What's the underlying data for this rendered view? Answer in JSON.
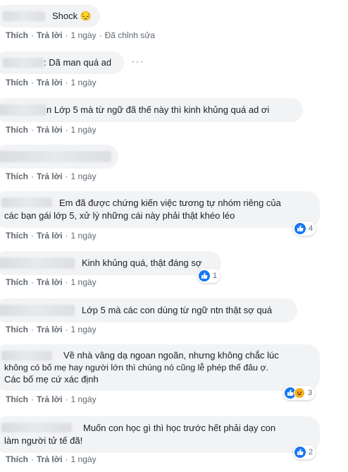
{
  "actions": {
    "like": "Thích",
    "reply": "Trả lời",
    "time": "1 ngày",
    "edited": "Đã chỉnh sửa"
  },
  "comments": [
    {
      "text": "Shock 😔",
      "reactions": null
    },
    {
      "text": ": Dã man quá ad",
      "more": "···",
      "reactions": null
    },
    {
      "text": "n Lớp 5 mà từ ngữ đã thế này thì kinh khủng quá ad ơi",
      "reactions": null
    },
    {
      "text": "",
      "reactions": null
    },
    {
      "lines": [
        "Em đã được chứng kiến việc tương tự nhóm riêng của",
        "các bạn gái lớp 5, xử lý những cái này phải thật khéo léo"
      ],
      "reactions": "4"
    },
    {
      "text": "Kinh khủng quá, thật đáng sợ",
      "reactions": "1"
    },
    {
      "text": "Lớp 5 mà các con dùng từ ngữ ntn thật sợ quá",
      "reactions": null
    },
    {
      "lines": [
        "Về nhà vâng dạ ngoan ngoãn, nhưng không chắc lúc",
        "không có bố mẹ hay người lớn thì chúng nó cũng lễ phép thế đâu ợ.",
        "Các bố mẹ cứ xác định"
      ],
      "reactions": "3"
    },
    {
      "lines": [
        "Muốn con học gì thì học trước hết phải dạy con",
        "làm người tử tế đã!"
      ],
      "reactions": "2"
    }
  ],
  "colors": {
    "bubble": "#f2f3f5",
    "like": "#1877f2",
    "meta": "#606770"
  },
  "icons": {
    "like": "like-icon",
    "haha": "haha-icon",
    "more": "more-options-icon"
  }
}
